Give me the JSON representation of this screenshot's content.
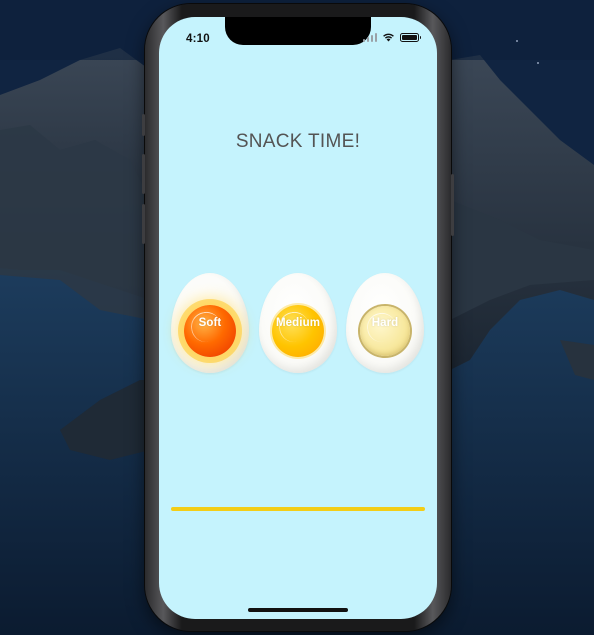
{
  "status_bar": {
    "time": "4:10"
  },
  "title": "SNACK TIME!",
  "eggs": [
    {
      "label": "Soft"
    },
    {
      "label": "Medium"
    },
    {
      "label": "Hard"
    }
  ],
  "progress": {
    "fraction": 1.0,
    "color": "#f3cd16"
  },
  "colors": {
    "screen_background": "#c5f3fd",
    "title_text": "#545454"
  },
  "icons": [
    "signal-icon",
    "wifi-icon",
    "battery-icon"
  ]
}
